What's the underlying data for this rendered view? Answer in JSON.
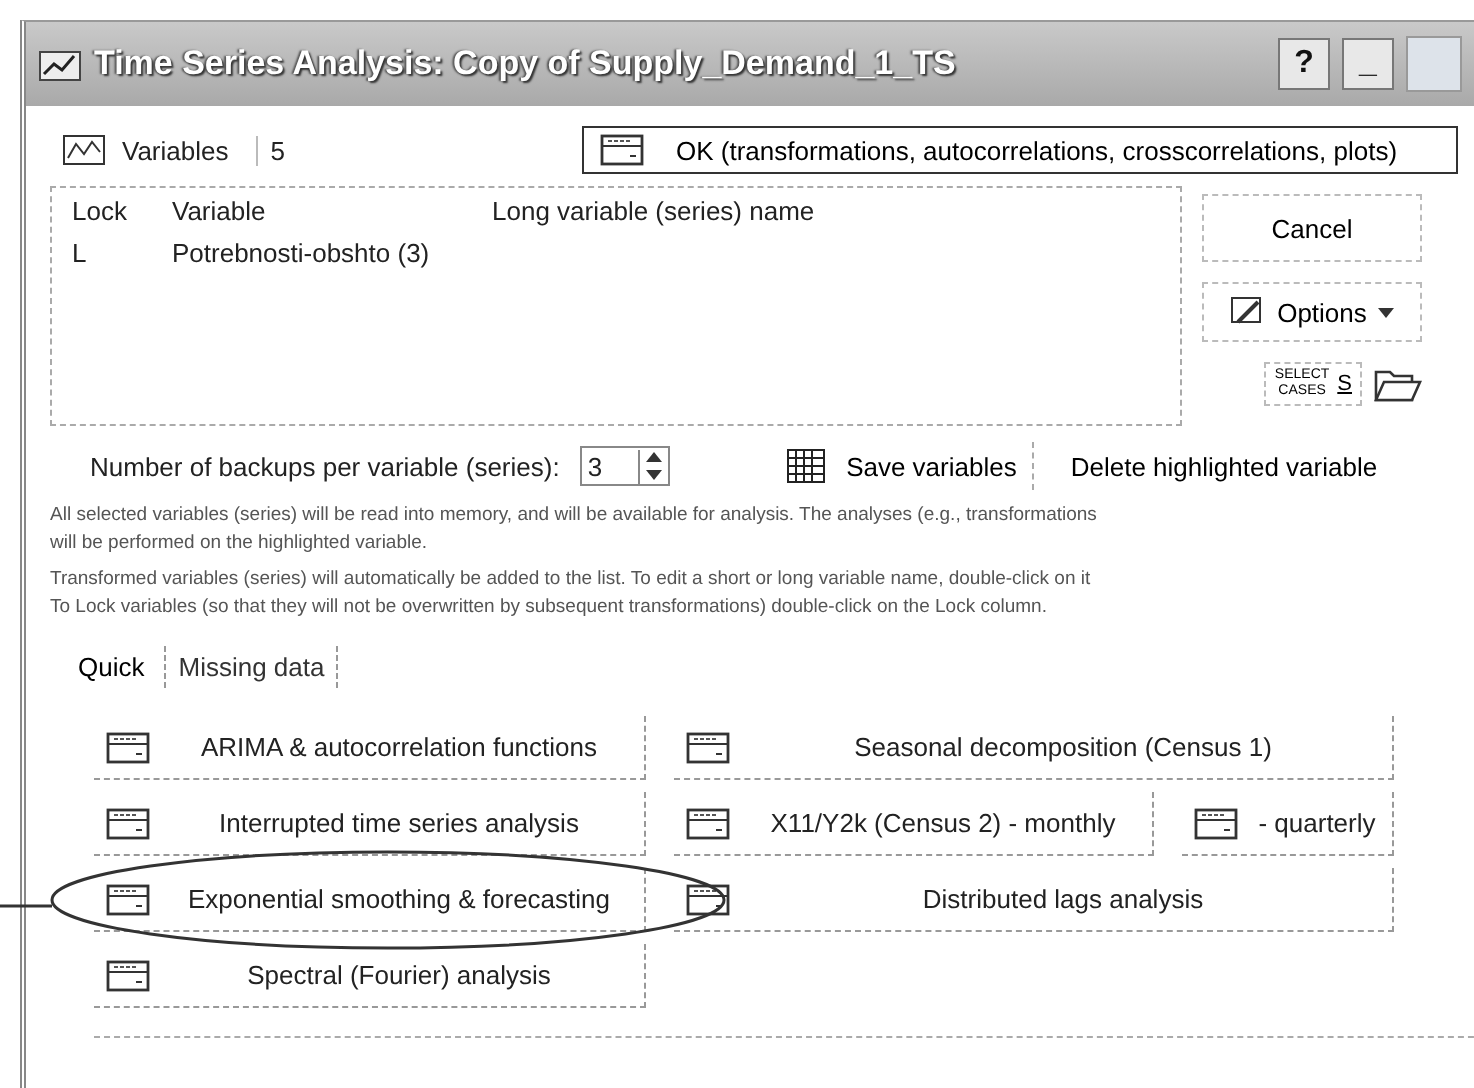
{
  "window": {
    "title": "Time Series Analysis: Copy of Supply_Demand_1_TS",
    "title_buttons": [
      "?",
      "_"
    ]
  },
  "variables_button": {
    "label": "Variables",
    "count": "5"
  },
  "ok_button": "OK (transformations, autocorrelations, crosscorrelations, plots)",
  "variable_list": {
    "columns": [
      "Lock",
      "Variable",
      "Long variable (series) name"
    ],
    "rows": [
      {
        "lock": "L",
        "variable": "Potrebnosti-obshto (3)"
      }
    ]
  },
  "side_buttons": {
    "cancel": "Cancel",
    "options": "Options",
    "select_cases": [
      "SELECT",
      "CASES"
    ],
    "select_cases_key": "S"
  },
  "backups": {
    "label": "Number of backups per variable (series):",
    "value": "3"
  },
  "save_button": "Save variables",
  "delete_button": "Delete highlighted variable",
  "info_lines": [
    "All selected variables (series) will be read into memory, and will be available for analysis. The analyses (e.g., transformations",
    "will be performed on the highlighted variable.",
    "Transformed variables (series) will automatically be added to the list. To edit a short or long variable name, double-click on it",
    "To Lock variables (so that they will not be overwritten by subsequent transformations) double-click on the Lock column."
  ],
  "tabs": [
    {
      "label": "Quick",
      "selected": true
    },
    {
      "label": "Missing data",
      "selected": false
    }
  ],
  "analysis_rows": [
    [
      {
        "label": "ARIMA & autocorrelation functions",
        "highlighted": false
      },
      {
        "label": "Seasonal decomposition (Census 1)",
        "highlighted": false
      }
    ],
    [
      {
        "label": "Interrupted time series analysis",
        "highlighted": false
      },
      {
        "label": "X11/Y2k (Census 2) - monthly",
        "highlighted": false
      },
      {
        "label": "- quarterly",
        "highlighted": false
      }
    ],
    [
      {
        "label": "Exponential smoothing & forecasting",
        "highlighted": true
      },
      {
        "label": "Distributed lags analysis",
        "highlighted": false
      }
    ],
    [
      {
        "label": "Spectral (Fourier) analysis",
        "highlighted": false
      }
    ]
  ]
}
